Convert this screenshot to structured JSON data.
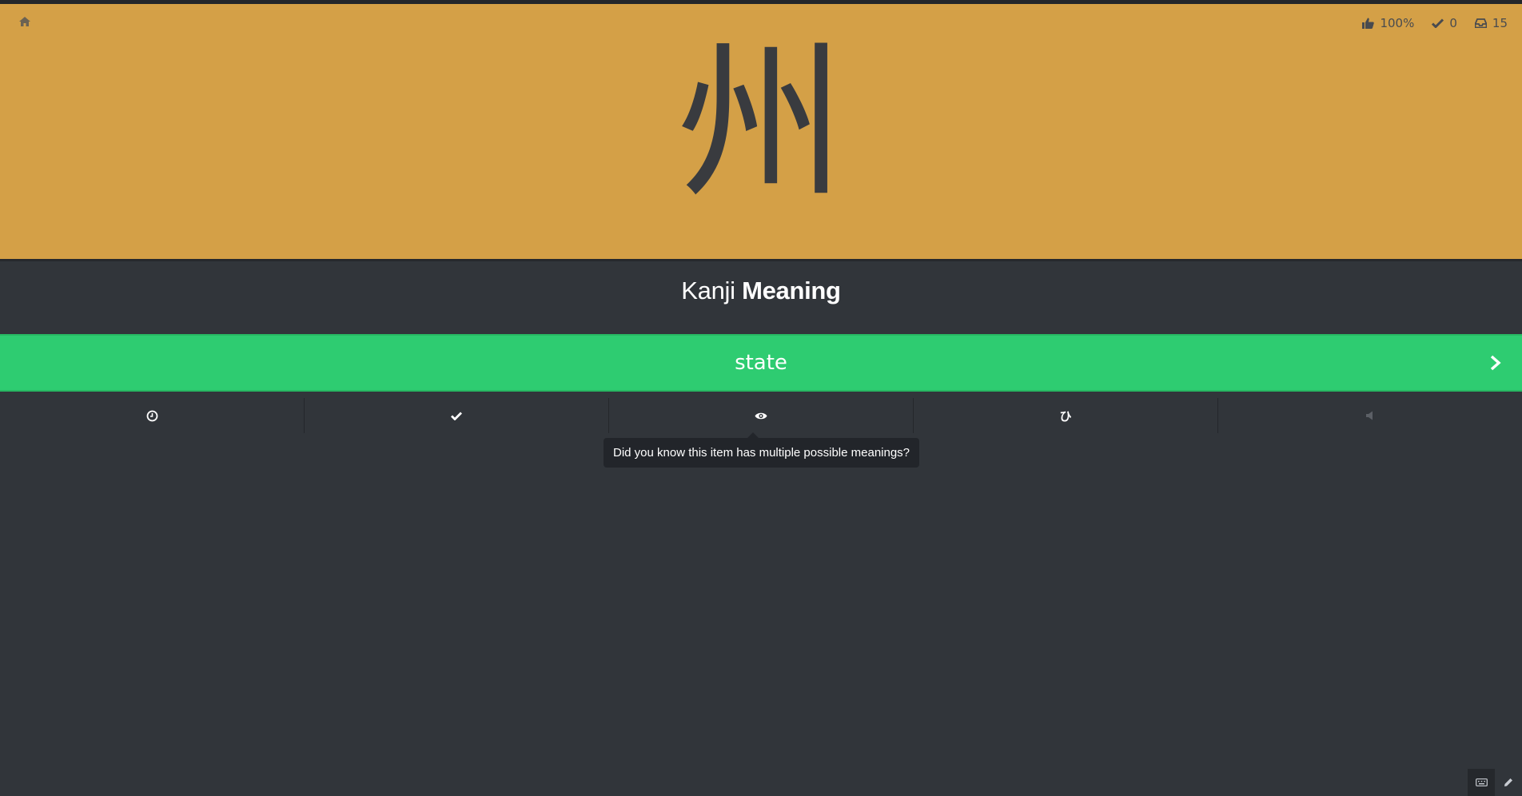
{
  "colors": {
    "character_panel": "#d4a047",
    "background": "#31353a",
    "answer_correct": "#2ecc71"
  },
  "header": {
    "home_icon": "home-icon",
    "stats": [
      {
        "icon": "thumbs-up-icon",
        "value": "100%"
      },
      {
        "icon": "check-icon",
        "value": "0"
      },
      {
        "icon": "inbox-icon",
        "value": "15"
      }
    ]
  },
  "review": {
    "character": "州",
    "prompt_type": "Kanji",
    "prompt_category": "Meaning",
    "answer_value": "state"
  },
  "toolbar": {
    "items": [
      {
        "icon": "clock-icon"
      },
      {
        "icon": "check-icon"
      },
      {
        "icon": "eye-icon"
      },
      {
        "icon": "hiragana-hi-icon",
        "glyph": "ひ"
      },
      {
        "icon": "speaker-icon"
      }
    ]
  },
  "tooltip": {
    "text": "Did you know this item has multiple possible meanings?"
  },
  "footer": {
    "icons": [
      "keyboard-icon",
      "pencil-icon"
    ]
  }
}
